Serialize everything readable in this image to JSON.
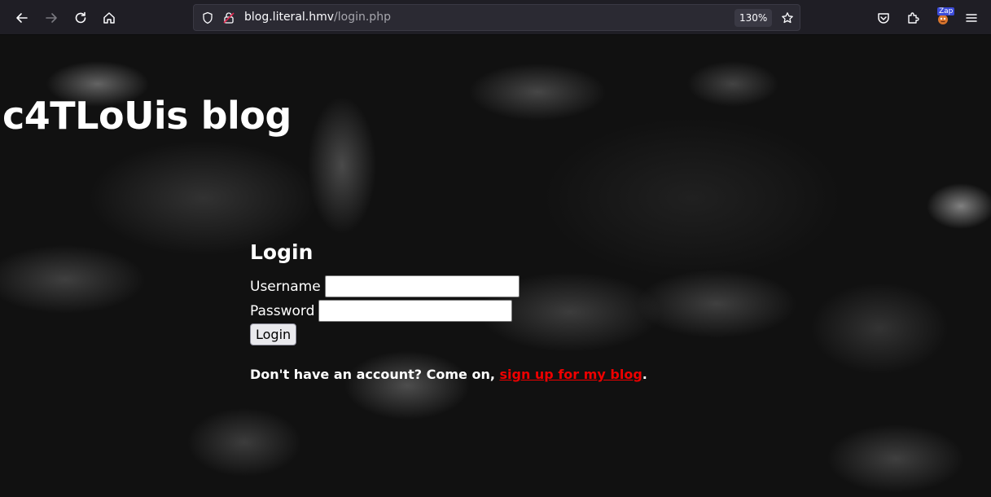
{
  "browser": {
    "url_host": "blog.literal.hmv",
    "url_path": "/login.php",
    "zoom": "130%",
    "extension_badge": "Zap",
    "icons": [
      "back-arrow-icon",
      "forward-arrow-icon",
      "reload-icon",
      "home-icon",
      "shield-icon",
      "insecure-lock-icon",
      "bookmark-star-icon",
      "pocket-icon",
      "extensions-icon",
      "zap-extension-icon",
      "menu-icon"
    ]
  },
  "page": {
    "blog_title": "c4TLoUis blog",
    "login": {
      "heading": "Login",
      "username_label": "Username",
      "username_value": "",
      "password_label": "Password",
      "password_value": "",
      "submit_label": "Login"
    },
    "signup": {
      "prefix": "Don't have an account? Come on, ",
      "link_text": "sign up for my blog",
      "suffix": "."
    }
  },
  "colors": {
    "link": "#ee0000",
    "toolbar_bg": "#1f1e25",
    "urlbar_bg": "#2b2a33"
  }
}
